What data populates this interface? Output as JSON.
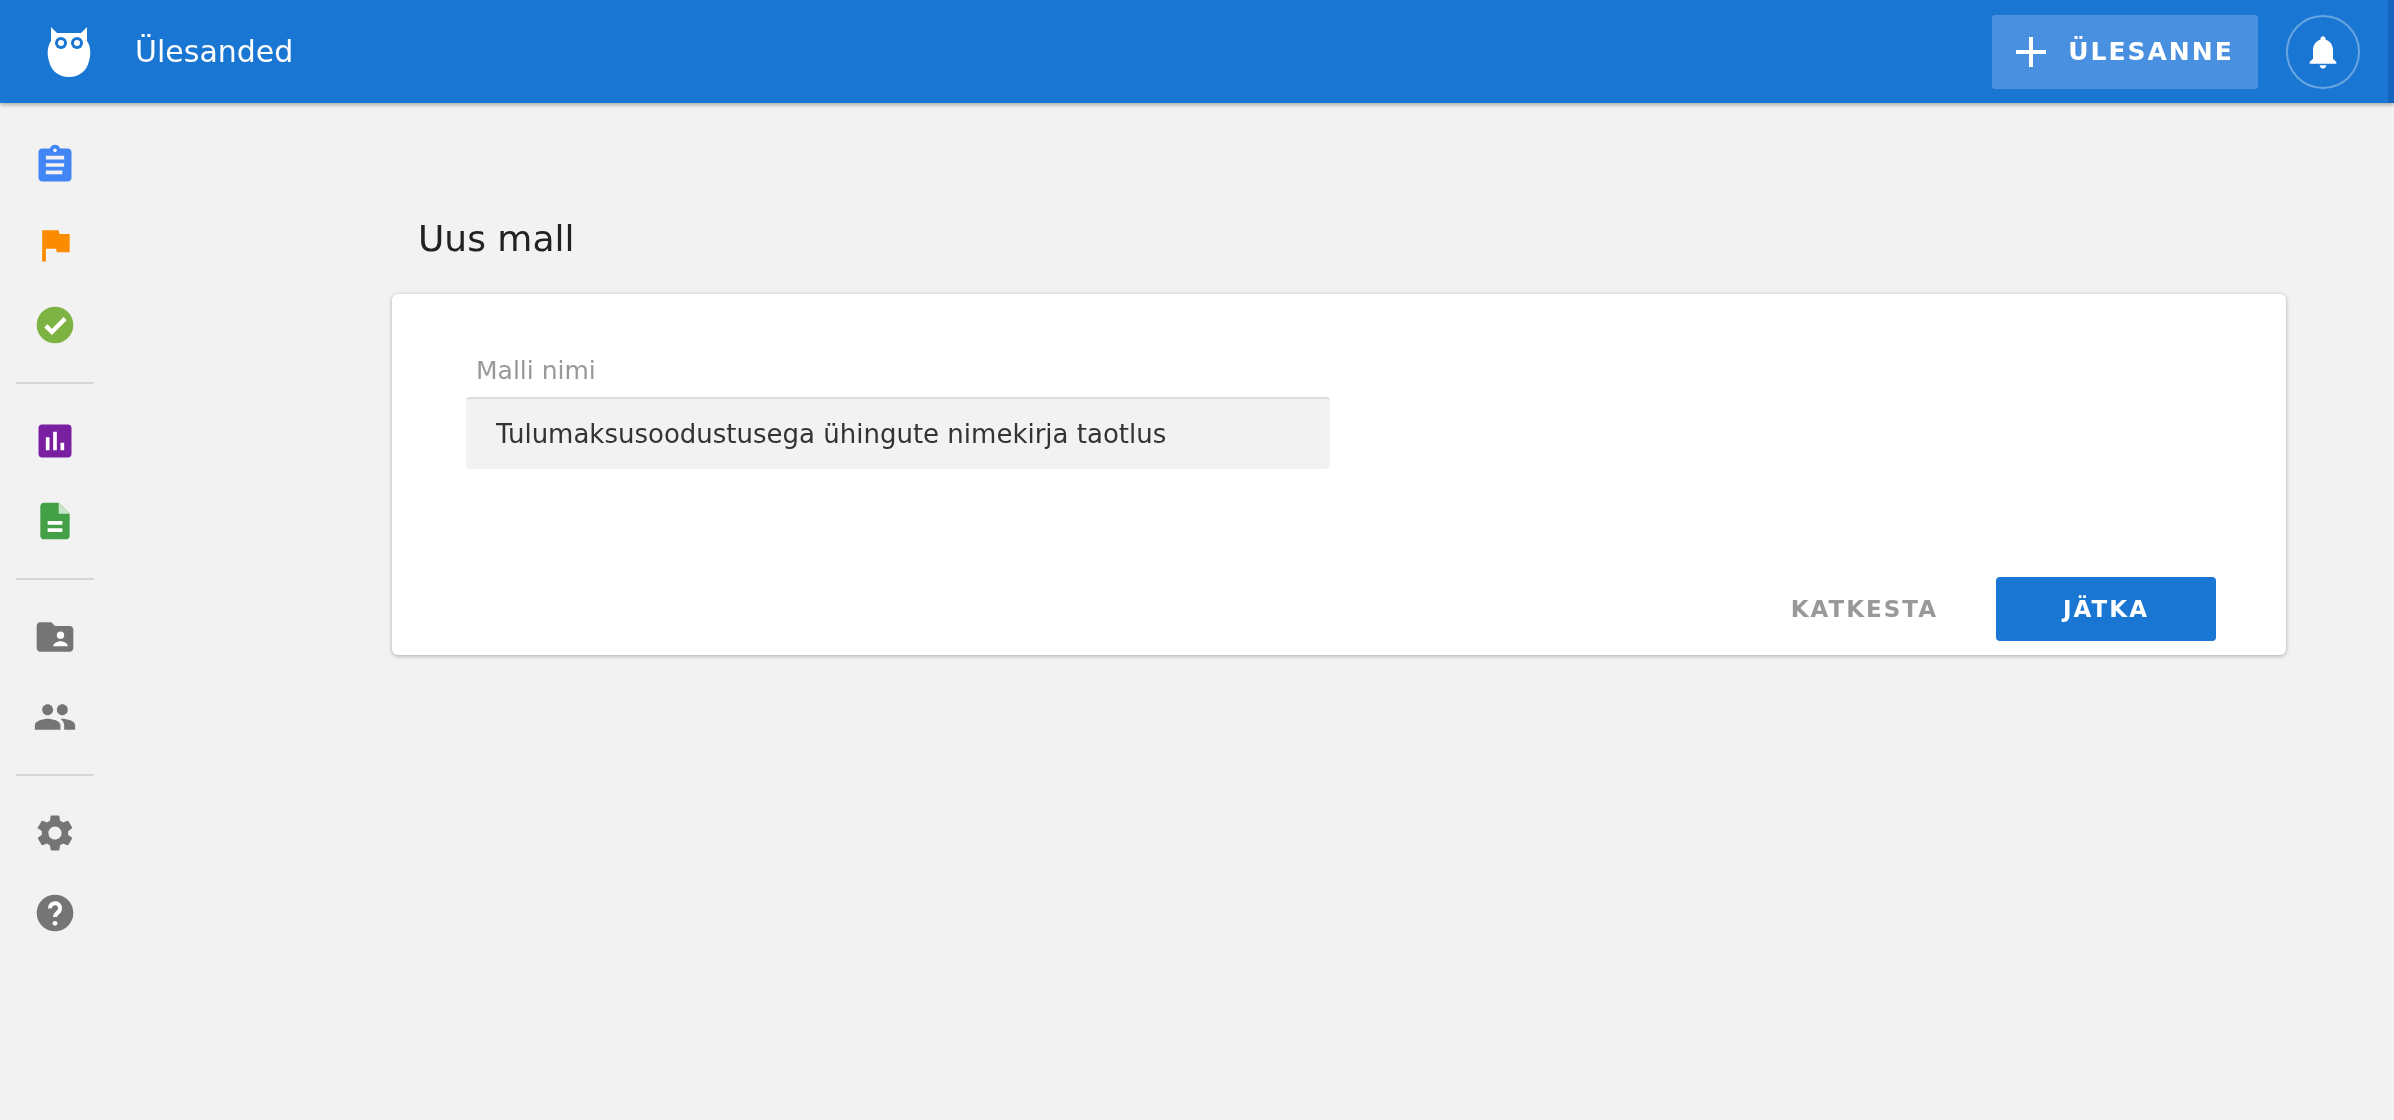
{
  "app_bar": {
    "title": "Ülesanded",
    "add_button": "ÜLESANNE"
  },
  "page": {
    "title": "Uus mall"
  },
  "form": {
    "field": {
      "label": "Malli nimi",
      "value": "Tulumaksusoodustusega ühingute nimekirja taotlus"
    },
    "buttons": [
      {
        "label": "KATKESTA",
        "kind": "text"
      },
      {
        "label": "JÄTKA",
        "kind": "primary"
      }
    ]
  }
}
